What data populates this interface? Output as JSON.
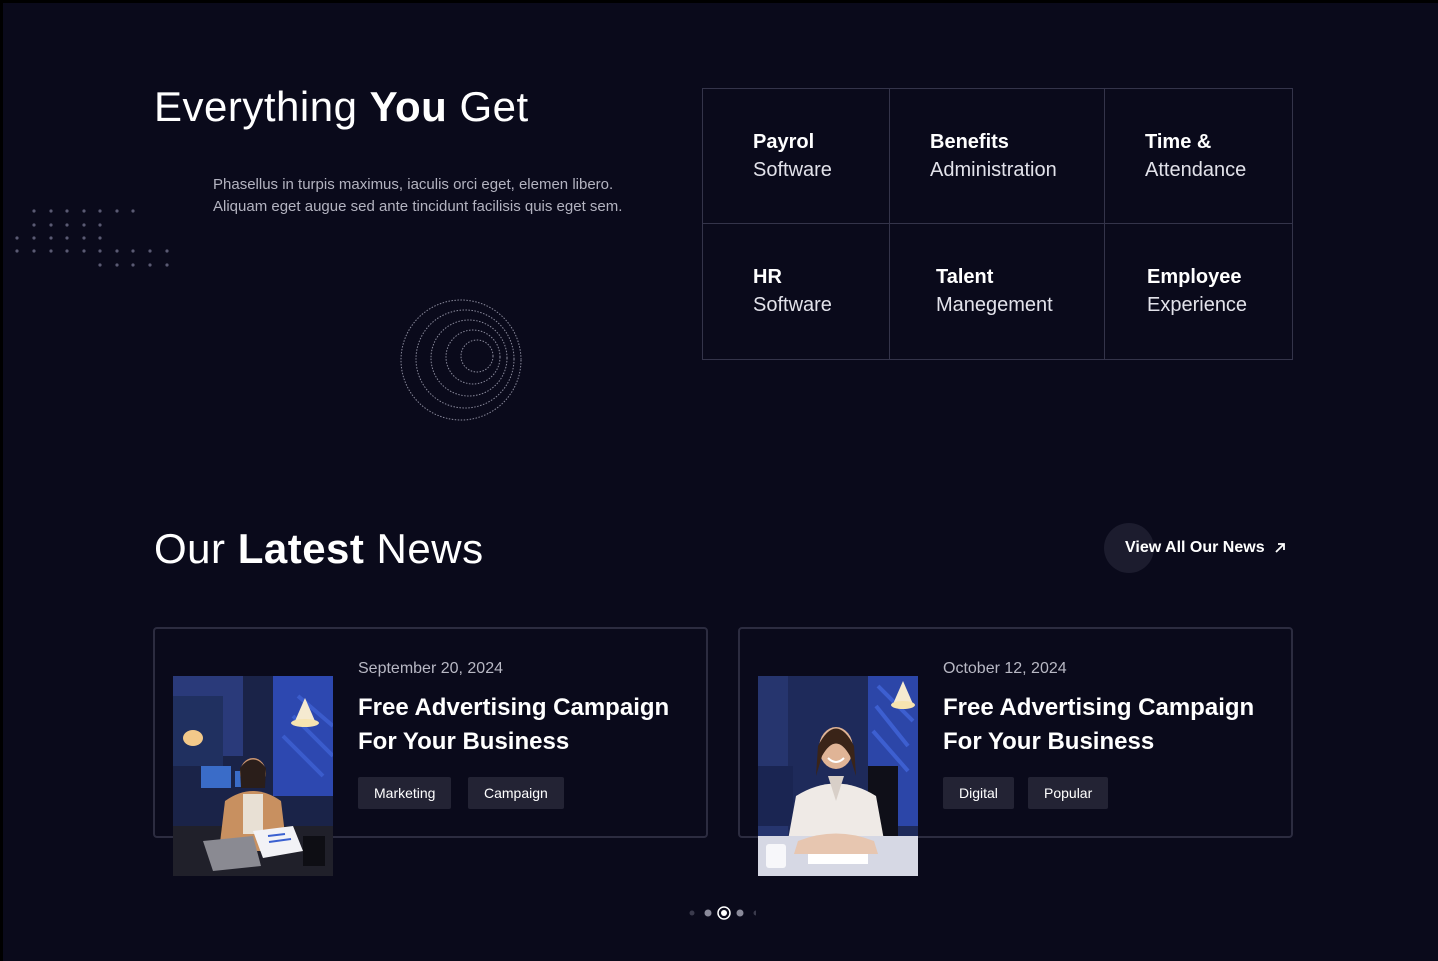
{
  "features": {
    "title_pre": "Everything ",
    "title_strong": "You",
    "title_post": " Get",
    "description": "Phasellus in turpis maximus, iaculis orci eget, elemen libero. Aliquam eget augue sed ante tincidunt facilisis quis eget sem.",
    "items": [
      {
        "bold": "Payrol",
        "light": "Software"
      },
      {
        "bold": "Benefits",
        "light": "Administration"
      },
      {
        "bold": "Time &",
        "light": "Attendance"
      },
      {
        "bold": "HR",
        "light": "Software"
      },
      {
        "bold": "Talent",
        "light": "Manegement"
      },
      {
        "bold": "Employee",
        "light": "Experience"
      }
    ]
  },
  "news": {
    "title_pre": "Our ",
    "title_strong": "Latest",
    "title_post": " News",
    "view_all_label": "View All Our News",
    "view_all_icon": "arrow-up-right-icon",
    "cards": [
      {
        "date": "September 20, 2024",
        "headline": "Free Advertising Campaign For Your Business",
        "tags": [
          "Marketing",
          "Campaign"
        ]
      },
      {
        "date": "October 12, 2024",
        "headline": "Free Advertising Campaign For Your Business",
        "tags": [
          "Digital",
          "Popular"
        ]
      }
    ]
  },
  "pager": {
    "dot_count": 5,
    "active_index": 2
  },
  "colors": {
    "background": "#0a0a1b",
    "border": "#34344a",
    "tag_bg": "#232334",
    "text_muted": "#b3b3c0"
  }
}
